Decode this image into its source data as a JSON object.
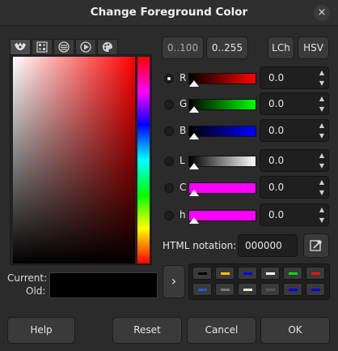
{
  "window": {
    "title": "Change Foreground Color",
    "close_glyph": "×"
  },
  "tabs": [
    {
      "name": "gimp-selector-icon",
      "active": true
    },
    {
      "name": "cmyk-selector-icon",
      "active": false
    },
    {
      "name": "watercolor-selector-icon",
      "active": false
    },
    {
      "name": "triangle-selector-icon",
      "active": false
    },
    {
      "name": "palette-selector-icon",
      "active": false
    }
  ],
  "range_buttons": {
    "r100": "0..100",
    "r255": "0..255"
  },
  "model_buttons": {
    "lch": "LCh",
    "hsv": "HSV"
  },
  "channels": [
    {
      "label": "R",
      "value": "0.0",
      "selected": true,
      "start": "#000000",
      "end": "#ff0000"
    },
    {
      "label": "G",
      "value": "0.0",
      "selected": false,
      "start": "#000000",
      "end": "#00ff00"
    },
    {
      "label": "B",
      "value": "0.0",
      "selected": false,
      "start": "#000000",
      "end": "#0000ff"
    },
    {
      "label": "L",
      "value": "0.0",
      "selected": false,
      "start": "#000000",
      "end": "#ffffff"
    },
    {
      "label": "C",
      "value": "0.0",
      "selected": false,
      "start": "#ff00ff",
      "end": "#ff00ff"
    },
    {
      "label": "h",
      "value": "0.0",
      "selected": false,
      "start": "#ff00ff",
      "end": "#ff00ff"
    }
  ],
  "html_notation": {
    "label": "HTML notation:",
    "value": "000000"
  },
  "current_old": {
    "current_label": "Current:",
    "old_label": "Old:",
    "current_color": "#000000"
  },
  "history": [
    "#000000",
    "#ffc000",
    "#0000ff",
    "#ffffff",
    "#00e000",
    "#ff1010",
    "#2060d0",
    "#7a7a7a",
    "#e8e8d0",
    "#555555",
    "#0000ff",
    "#0000ff"
  ],
  "footer": {
    "help": "Help",
    "reset": "Reset",
    "cancel": "Cancel",
    "ok": "OK"
  }
}
